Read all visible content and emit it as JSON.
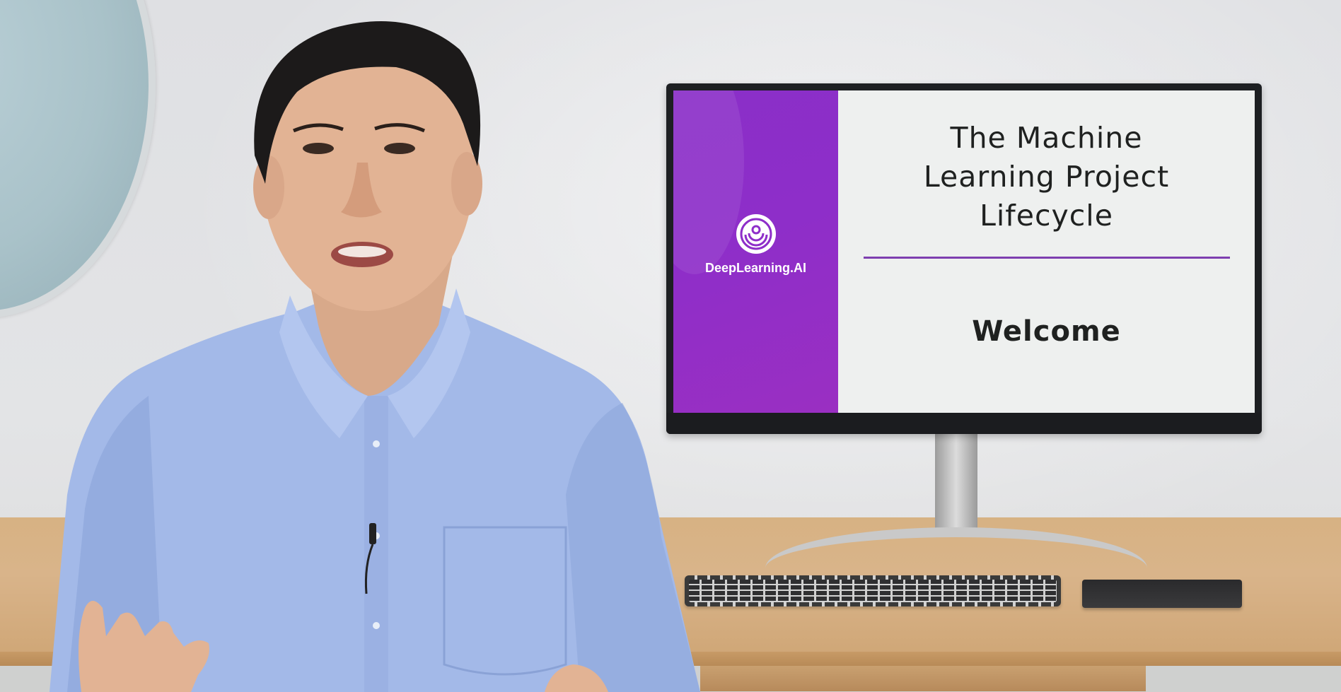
{
  "monitor": {
    "logo_text": "DeepLearning.AI",
    "slide_title": "The Machine\nLearning Project\nLifecycle",
    "slide_subtitle": "Welcome"
  },
  "colors": {
    "slide_purple": "#8e2ec9",
    "slide_rule": "#7e3fb0",
    "shirt_blue": "#9fb6e6",
    "desk_wood": "#d7b283"
  }
}
